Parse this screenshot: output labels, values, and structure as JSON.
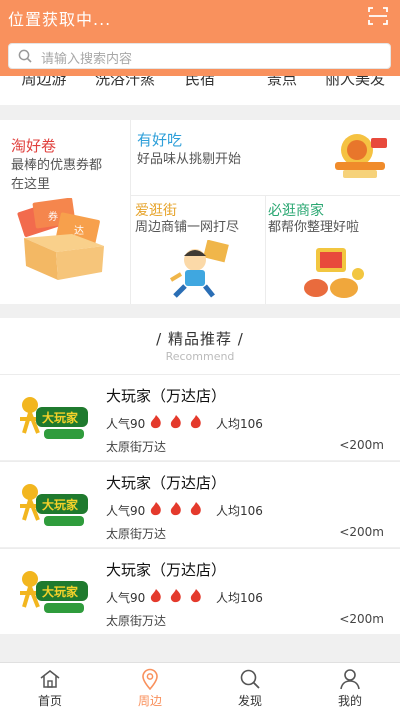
{
  "header": {
    "location_text": "位置获取中...",
    "search_placeholder": "请输入搜索内容"
  },
  "categories": [
    "周边游",
    "洗浴汗蒸",
    "民宿",
    "景点",
    "丽人美发"
  ],
  "promo": {
    "coupon": {
      "title": "淘好卷",
      "desc_line1": "最棒的优惠券都",
      "desc_line2": "在这里",
      "badge1": "券",
      "badge2": "达"
    },
    "food": {
      "title": "有好吃",
      "desc": "好品味从挑剔开始"
    },
    "shopping": {
      "title": "爱逛街",
      "desc": "周边商铺一网打尽"
    },
    "merchant": {
      "title": "必逛商家",
      "desc": "都帮你整理好啦"
    }
  },
  "recommend": {
    "title": "/  精品推荐  /",
    "subtitle": "Recommend"
  },
  "items": [
    {
      "name": "大玩家（万达店）",
      "popularity": "人气90",
      "avg": "人均106",
      "address": "太原街万达",
      "distance": "<200m",
      "logo_text": "大玩家"
    },
    {
      "name": "大玩家（万达店）",
      "popularity": "人气90",
      "avg": "人均106",
      "address": "太原街万达",
      "distance": "<200m",
      "logo_text": "大玩家"
    },
    {
      "name": "大玩家（万达店）",
      "popularity": "人气90",
      "avg": "人均106",
      "address": "太原街万达",
      "distance": "<200m",
      "logo_text": "大玩家"
    }
  ],
  "nav": [
    {
      "label": "首页",
      "icon": "home-icon"
    },
    {
      "label": "周边",
      "icon": "location-pin-icon",
      "active": true
    },
    {
      "label": "发现",
      "icon": "search-icon"
    },
    {
      "label": "我的",
      "icon": "user-icon"
    }
  ],
  "colors": {
    "accent": "#f9915d",
    "coupon_title": "#e0413e",
    "food_title": "#2e9fd9",
    "shopping_title": "#e6a32a",
    "merchant_title": "#2aa772",
    "flame": "#e43a2c"
  }
}
